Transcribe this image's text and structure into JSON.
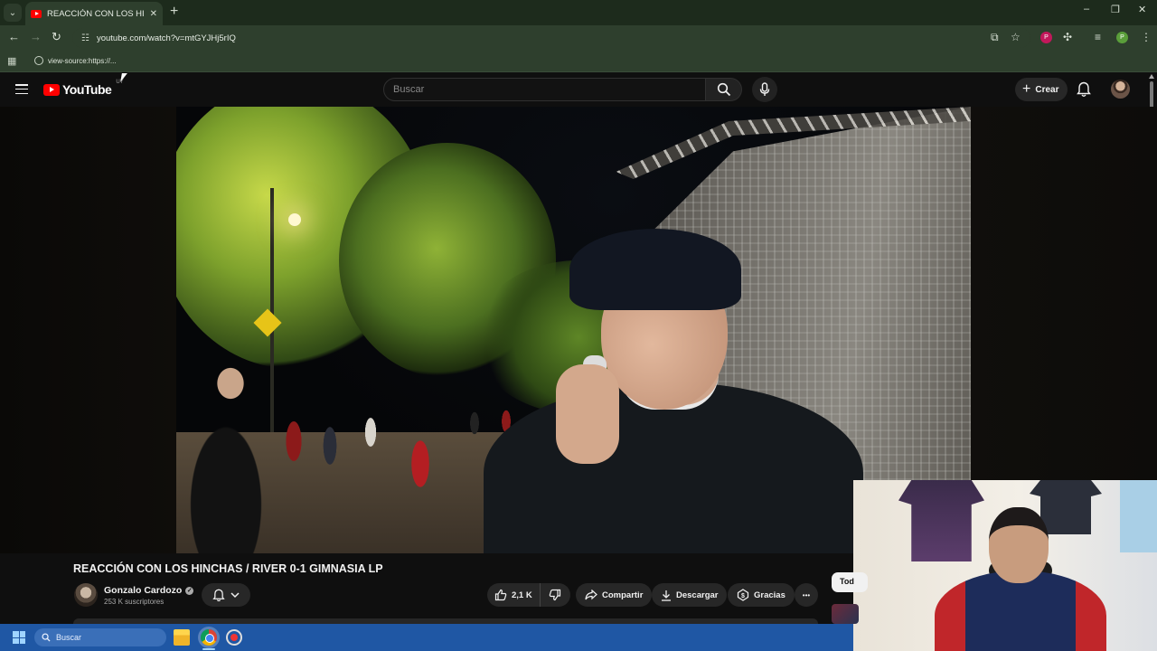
{
  "browser": {
    "tab_title": "REACCIÓN CON LOS HINCHAS",
    "tab_close": "✕",
    "new_tab": "+",
    "url": "youtube.com/watch?v=mtGYJHj5rIQ",
    "bookmark_label": "view-source:https://...",
    "profile_initial_1": "P",
    "profile_initial_2": "P",
    "window_controls": [
      "–",
      "❐",
      "✕"
    ]
  },
  "youtube": {
    "logo_text": "YouTube",
    "country_code": "UY",
    "search_placeholder": "Buscar",
    "create_label": "Crear",
    "create_plus": "+"
  },
  "video": {
    "title": "REACCIÓN CON LOS HINCHAS / RIVER 0-1 GIMNASIA LP",
    "channel_name": "Gonzalo Cardozo",
    "verified_mark": "✓",
    "subscribers": "253 K suscriptores",
    "like_count": "2,1 K",
    "share_label": "Compartir",
    "download_label": "Descargar",
    "thanks_label": "Gracias",
    "more_label": "•••",
    "chip_label": "Tod"
  },
  "taskbar": {
    "search_label": "Buscar"
  },
  "colors": {
    "youtube_red": "#ff0000",
    "browser_frame": "#2e3f2d",
    "page_bg": "#0f0f0f",
    "taskbar": "#1f57a4"
  },
  "icons": [
    "tab-list-icon",
    "youtube-favicon-icon",
    "back-icon",
    "forward-icon",
    "reload-icon",
    "site-info-icon",
    "install-icon",
    "star-icon",
    "extensions-icon",
    "media-icon",
    "menu-icon",
    "apps-icon",
    "globe-icon",
    "hamburger-icon",
    "search-icon",
    "mic-icon",
    "bell-icon",
    "like-icon",
    "dislike-icon",
    "share-icon",
    "download-icon",
    "thanks-icon",
    "windows-logo-icon",
    "folder-icon",
    "chrome-icon",
    "record-icon"
  ]
}
